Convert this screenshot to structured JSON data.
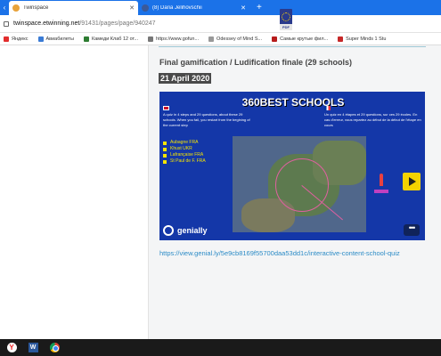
{
  "browser": {
    "tabs": [
      {
        "title": "Twinspace",
        "active": true
      },
      {
        "title": "(8) Daria Jelihovschii",
        "active": false
      }
    ],
    "new_tab": "+",
    "url_host": "twinspace.etwinning.net",
    "url_path": "/91431/pages/page/940247",
    "bookmarks": [
      {
        "label": "Яндекс",
        "icon": "yandex-icon",
        "color": "#e22d2d"
      },
      {
        "label": "Авиабилеты",
        "icon": "plane-icon",
        "color": "#3a7bd5"
      },
      {
        "label": "Камеди Клаб 12 от...",
        "icon": "video-icon",
        "color": "#2e7d32"
      },
      {
        "label": "https://www.gofun...",
        "icon": "globe-icon",
        "color": "#777777"
      },
      {
        "label": "Odessey of Mind S...",
        "icon": "page-icon",
        "color": "#999999"
      },
      {
        "label": "Самые крутые фил...",
        "icon": "film-icon",
        "color": "#b71c1c"
      },
      {
        "label": "Super Minds 1 Stu",
        "icon": "book-icon",
        "color": "#c62828"
      }
    ]
  },
  "page": {
    "pdf_label": "PDF",
    "heading": "Final gamification / Ludification finale (29 schools)",
    "date": "21 April 2020",
    "embed": {
      "title": "360BEST SCHOOLS",
      "text_en": "A quiz in 4 steps and 29 questions, about these 29 schools. When you fail, you restart from the begining of the current step",
      "text_fr": "Un quiz en 4 étapes et 29 questions, sur ces 29 écoles. En cas d'erreur, vous repartez au début de la début de l'étape en cours",
      "schools": [
        "Aubagne FRA",
        "Khust UKR",
        "Lafrançaise FRA",
        "St Paul de F. FRA"
      ],
      "brand": "genially",
      "more": "•••",
      "colors": {
        "background": "#1437a8",
        "accent": "#f5d200"
      }
    },
    "link": "https://view.genial.ly/5e9cb8169f55700daa53dd1c/interactive-content-school-quiz",
    "accent_color": "#2b8bc6"
  },
  "taskbar": {
    "items": [
      {
        "name": "yandex-browser-icon",
        "label": "Y"
      },
      {
        "name": "word-icon",
        "label": "W"
      },
      {
        "name": "chrome-icon",
        "label": ""
      }
    ]
  }
}
